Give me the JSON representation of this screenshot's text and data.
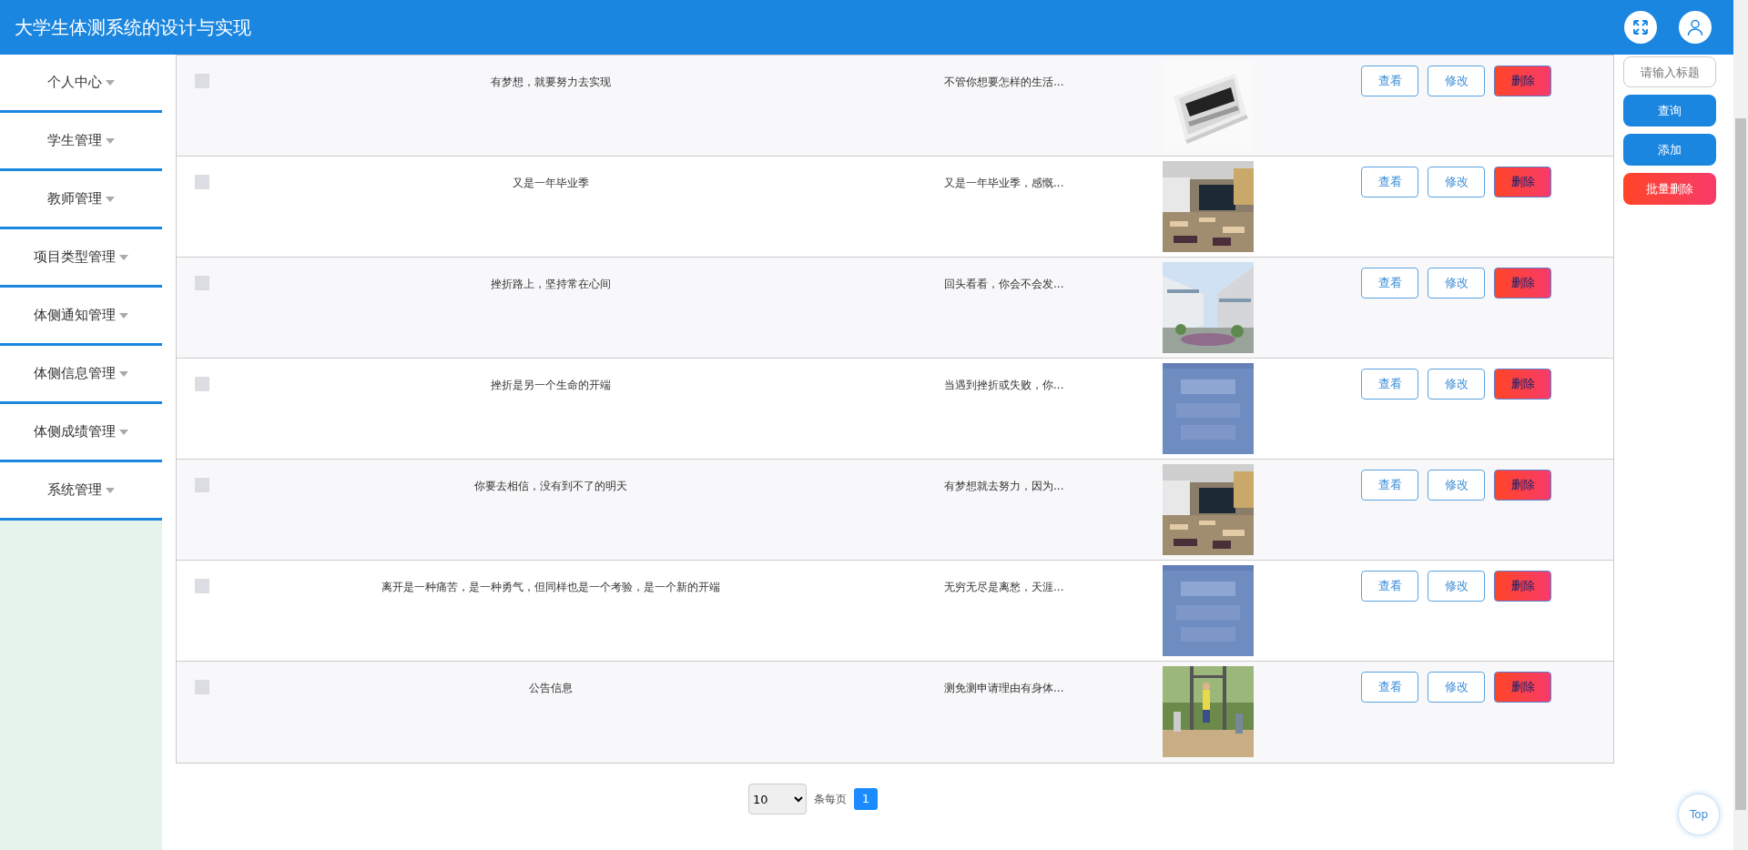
{
  "header": {
    "title": "大学生体测系统的设计与实现"
  },
  "sidebar": {
    "items": [
      {
        "label": "个人中心",
        "expanded": false
      },
      {
        "label": "学生管理",
        "expanded": false
      },
      {
        "label": "教师管理",
        "expanded": false
      },
      {
        "label": "项目类型管理",
        "expanded": false
      },
      {
        "label": "体侧通知管理",
        "expanded": false
      },
      {
        "label": "体侧信息管理",
        "expanded": false
      },
      {
        "label": "体侧成绩管理",
        "expanded": false
      },
      {
        "label": "系统管理",
        "expanded": false
      }
    ]
  },
  "table": {
    "rows": [
      {
        "checked": false,
        "title": "有梦想，就要努力去实现",
        "intro": "不管你想要怎样的生活...",
        "actions": [
          "查看",
          "修改",
          "删除"
        ]
      },
      {
        "checked": false,
        "title": "又是一年毕业季",
        "intro": "又是一年毕业季，感慨...",
        "actions": [
          "查看",
          "修改",
          "删除"
        ]
      },
      {
        "checked": false,
        "title": "挫折路上，坚持常在心间",
        "intro": "回头看看，你会不会发...",
        "actions": [
          "查看",
          "修改",
          "删除"
        ]
      },
      {
        "checked": false,
        "title": "挫折是另一个生命的开端",
        "intro": "当遇到挫折或失败，你...",
        "actions": [
          "查看",
          "修改",
          "删除"
        ]
      },
      {
        "checked": false,
        "title": "你要去相信，没有到不了的明天",
        "intro": "有梦想就去努力，因为...",
        "actions": [
          "查看",
          "修改",
          "删除"
        ]
      },
      {
        "checked": false,
        "title": "离开是一种痛苦，是一种勇气，但同样也是一个考验，是一个新的开端",
        "intro": "无穷无尽是离愁，天涯...",
        "actions": [
          "查看",
          "修改",
          "删除"
        ]
      },
      {
        "checked": false,
        "title": "公告信息",
        "intro": "测免测申请理由有身体...",
        "actions": [
          "查看",
          "修改",
          "删除"
        ]
      }
    ]
  },
  "search": {
    "placeholder": "请输入标题",
    "buttons": [
      "查询",
      "添加",
      "批量删除"
    ]
  },
  "pagination": {
    "page_size": "10",
    "label": "条每页",
    "pages": [
      {
        "label": "1",
        "selected": true
      }
    ]
  },
  "top_button": {
    "label": "Top"
  }
}
